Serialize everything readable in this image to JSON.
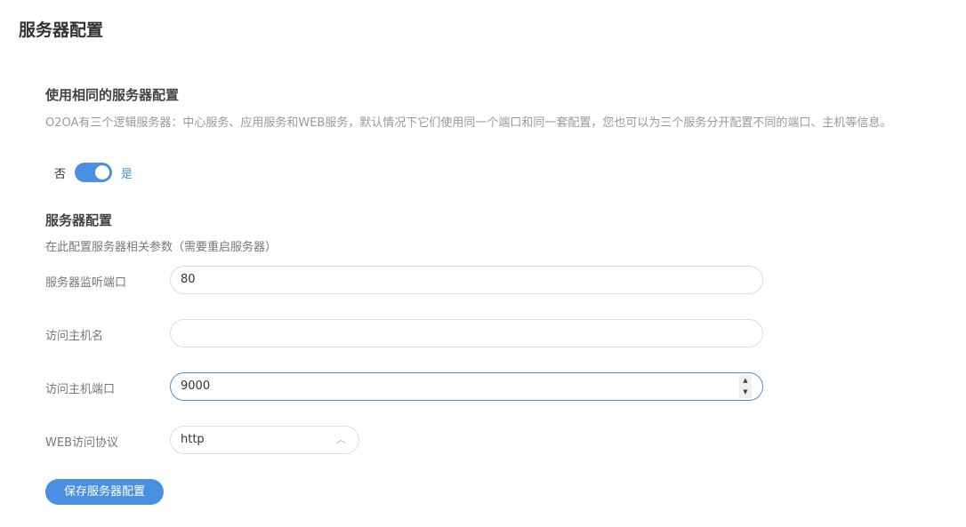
{
  "page_title": "服务器配置",
  "same_config": {
    "title": "使用相同的服务器配置",
    "description": "O2OA有三个逻辑服务器：中心服务、应用服务和WEB服务，默认情况下它们使用同一个端口和同一套配置，您也可以为三个服务分开配置不同的端口、主机等信息。",
    "off_label": "否",
    "on_label": "是",
    "enabled": true
  },
  "server_config": {
    "title": "服务器配置",
    "description": "在此配置服务器相关参数（需要重启服务器）",
    "fields": [
      {
        "label": "服务器监听端口",
        "value": "80"
      },
      {
        "label": "访问主机名",
        "value": ""
      },
      {
        "label": "访问主机端口",
        "value": "9000"
      },
      {
        "label": "WEB访问协议",
        "value": "http"
      }
    ],
    "save_label": "保存服务器配置"
  }
}
